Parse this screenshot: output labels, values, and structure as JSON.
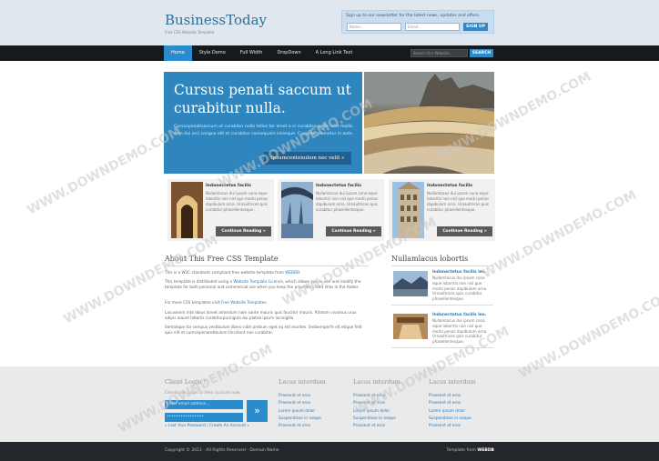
{
  "header": {
    "logo": "BusinessToday",
    "tagline": "Free CSS Website Template",
    "newsletter": {
      "text": "Sign up to our newsletter for the latest news, updates and offers.",
      "name_placeholder": "Name...",
      "email_placeholder": "Email...",
      "button": "SIGN UP"
    }
  },
  "nav": {
    "items": [
      "Home",
      "Style Demo",
      "Full Width",
      "DropDown",
      "A Long Link Text"
    ],
    "search_placeholder": "Search Our Website...",
    "search_button": "SEARCH"
  },
  "hero": {
    "title": "Cursus penati saccum ut curabitur nulla.",
    "text": "Cursuspenatisaccum ut curabitur nulla tellus tor amet a in curabitur pede. Idet mollis sem dui orci congue elit et curabitur consequam intesque. Curabiturplametur in ante.",
    "button": "Ipsumcentenulum nec velit »"
  },
  "features": [
    {
      "title": "Indonectetus facilis",
      "text": "Nullamlacus dui ipsum cona eque loboritis non nisl que morbi penas dapibulum orna. Urnaultrices quis curabitur phasellentesque.",
      "button": "Continue Reading »"
    },
    {
      "title": "Indonectetus facilis",
      "text": "Nullamlacus dui ipsum cona eque loboritis non nisl que morbi penas dapibulum orna. Urnaultrices quis curabitur phasellentesque.",
      "button": "Continue Reading »"
    },
    {
      "title": "Indonectetus facilis",
      "text": "Nullamlacus dui ipsum cona eque loboritis non nisl que morbi penas dapibulum orna. Urnaultrices quis curabitur phasellentesque.",
      "button": "Continue Reading »"
    }
  ],
  "about": {
    "title": "About This Free CSS Template",
    "p1_pre": "This is a W3C standards compliant free website template from ",
    "p1_link": "WEBDB",
    "p1_post": ".",
    "p2_pre": "This template is distributed using a ",
    "p2_link": "Website Template Licence",
    "p2_post": ", which allows you to use and modify the template for both personal and commercial use when you keep the provided credit links in the footer.",
    "p3_pre": "For more CSS templates visit ",
    "p3_link": "Free Website Templates",
    "p3_post": ".",
    "p4": "Lacusenim inte dolus loreet anterdum nam sante mauris quis faucitor mauris. Ritstom vivamus urus adipis ioaunt loborlis curabiturpuringula dui platea ipsum lacinigilla.",
    "p5": "Semalique tor sempus vestibulum libero nibh pretium eget eu elit montes. Sedaemperfe elt etique felit quis elit et cumssipenaretibulum tincidunt non curabitar."
  },
  "sidebar": {
    "title": "Nullamlacus lobortis",
    "items": [
      {
        "title": "Indonectetus facilis leo.",
        "text": "Nullamlacus dui ipsum cona eque loboritis non nisl que morbi penas dapibulum orna. Urnaultrices quis curabitur phasellentesque."
      },
      {
        "title": "Indonectetus facilis leo.",
        "text": "Nullamlacus dui ipsum cona eque loboritis non nisl que morbi penas dapibulum orna. Urnaultrices quis curabitur phasellentesque."
      }
    ]
  },
  "footer": {
    "login": {
      "title": "Client Login !",
      "subtitle": "Clients use Login to their account now.",
      "email_placeholder": "Enter email address...",
      "password_value": "••••••••••••••••",
      "go": "»",
      "lost_password": "» Lost Your Password",
      "separator": " | ",
      "create_account": "Create An Account »"
    },
    "columns": [
      {
        "title": "Lacus interdum",
        "items": [
          "Praesent et eros",
          "Praesent et eros",
          "Lorem ipsum dolor",
          "Suspendisse in neque",
          "Praesent et eros"
        ]
      },
      {
        "title": "Lacus interdum",
        "items": [
          "Praesent et eros",
          "Praesent et eros",
          "Lorem ipsum dolor",
          "Suspendisse in neque",
          "Praesent et eros"
        ]
      },
      {
        "title": "Lacus interdum",
        "items": [
          "Praesent et eros",
          "Praesent et eros",
          "Lorem ipsum dolor",
          "Suspendisse in neque",
          "Praesent et eros"
        ]
      }
    ]
  },
  "bottom": {
    "copyright": "Copyright © 2011 - All Rights Reserved - Domain Name",
    "credit_pre": "Template from ",
    "credit_link": "WEBDB"
  },
  "watermark": "WWW.DOWNDEMO.COM"
}
